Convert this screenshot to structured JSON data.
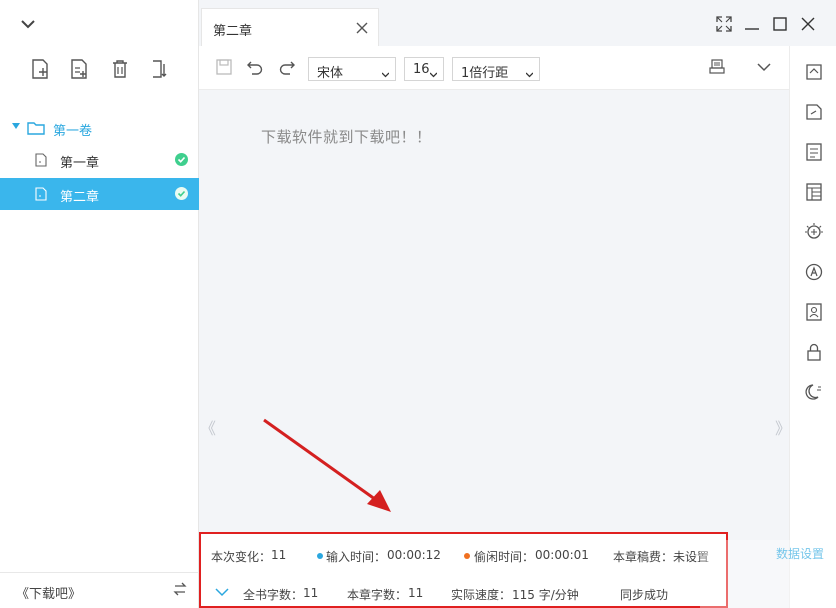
{
  "sidebar": {
    "volume_label": "第一卷",
    "chapters": [
      {
        "label": "第一章",
        "saved": true,
        "active": false
      },
      {
        "label": "第二章",
        "saved": true,
        "active": true
      }
    ],
    "footer_book": "《下载吧》"
  },
  "tab": {
    "title": "第二章"
  },
  "toolbar": {
    "font": "宋体",
    "size": "16",
    "line_spacing": "1倍行距"
  },
  "editor": {
    "content": "下载软件就到下载吧！！"
  },
  "status": {
    "change_label": "本次变化：",
    "change_value": "11",
    "input_time_label": "输入时间：",
    "input_time_value": "00:00:12",
    "idle_time_label": "偷闲时间：",
    "idle_time_value": "00:00:01",
    "fee_label": "本章稿费：",
    "fee_value": "未设置",
    "book_words_label": "全书字数：",
    "book_words_value": "11",
    "chapter_words_label": "本章字数：",
    "chapter_words_value": "11",
    "speed_label": "实际速度：",
    "speed_value": "115 字/分钟",
    "sync": "同步成功",
    "data_settings": "数据设置"
  },
  "colors": {
    "accent": "#2aa7df",
    "active_row": "#3ab6ec",
    "saved_check": "#3fcf8e",
    "input_dot": "#2aa7df",
    "idle_dot": "#f07020",
    "highlight_box": "#e02020"
  }
}
